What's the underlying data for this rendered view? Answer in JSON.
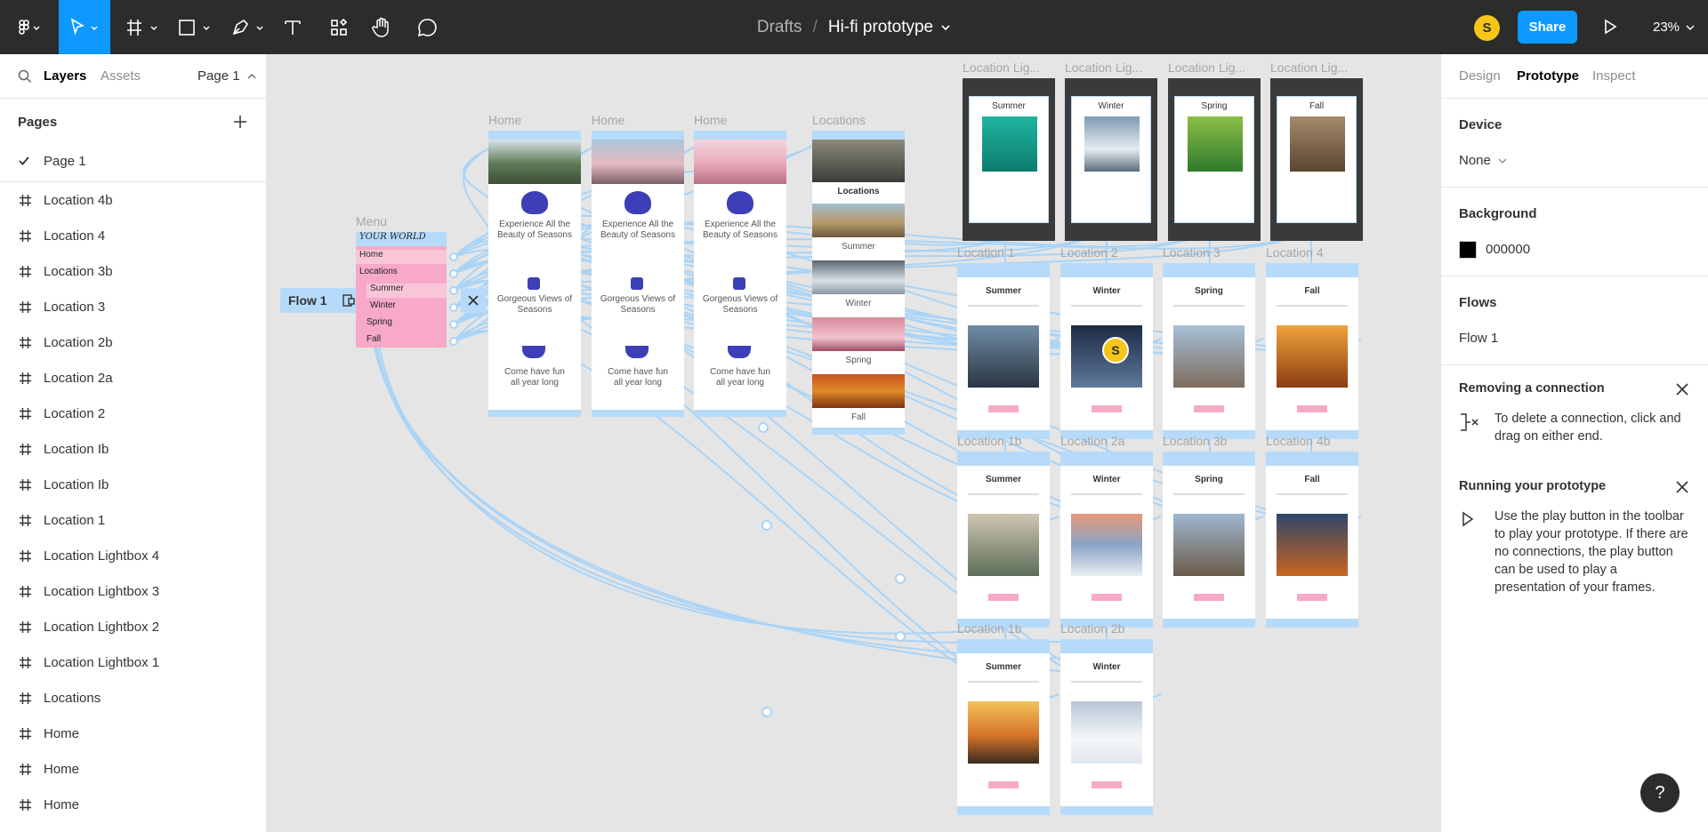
{
  "toolbar": {
    "breadcrumb_root": "Drafts",
    "breadcrumb_sep": "/",
    "project_name": "Hi-fi prototype",
    "user_initial": "S",
    "share_label": "Share",
    "zoom": "23%"
  },
  "left_panel": {
    "tabs": {
      "layers": "Layers",
      "assets": "Assets",
      "page_selector": "Page 1"
    },
    "pages_heading": "Pages",
    "pages": [
      "Page 1"
    ],
    "layers": [
      "Location 4b",
      "Location 4",
      "Location 3b",
      "Location 3",
      "Location 2b",
      "Location 2a",
      "Location 2",
      "Location Ib",
      "Location Ib",
      "Location 1",
      "Location Lightbox 4",
      "Location Lightbox 3",
      "Location Lightbox 2",
      "Location Lightbox 1",
      "Locations",
      "Home",
      "Home",
      "Home"
    ]
  },
  "right_panel": {
    "tabs": {
      "design": "Design",
      "prototype": "Prototype",
      "inspect": "Inspect"
    },
    "device_heading": "Device",
    "device_value": "None",
    "background_heading": "Background",
    "background_hex": "000000",
    "flows_heading": "Flows",
    "flow_item": "Flow 1",
    "remove_conn_heading": "Removing a connection",
    "remove_conn_text": "To delete a connection, click and drag on either end.",
    "running_heading": "Running your prototype",
    "running_text": "Use the play button in the toolbar to play your prototype. If there are no connections, the play button can be used to play a presentation of your frames."
  },
  "canvas": {
    "flow_badge": "Flow 1",
    "menu_label": "Menu",
    "menu_items": [
      "YOUR WORLD",
      "Home",
      "Locations",
      "Summer",
      "Winter",
      "Spring",
      "Fall"
    ],
    "home_label": "Home",
    "home_text": {
      "headline": "Experience All the Beauty of Seasons",
      "views": "Gorgeous Views of Seasons",
      "fun": "Come have fun all year long"
    },
    "locations_label": "Locations",
    "locations_title": "Locations",
    "seasons": [
      "Summer",
      "Winter",
      "Spring",
      "Fall"
    ],
    "lightbox_labels": [
      "Location Lig...",
      "Location Lig...",
      "Location Lig...",
      "Location Lig..."
    ],
    "row1_labels": [
      "Location 1",
      "Location 2",
      "Location 3",
      "Location 4"
    ],
    "row2_labels": [
      "Location 1b",
      "Location 2a",
      "Location 3b",
      "Location 4b"
    ],
    "row3_labels": [
      "Location 1b",
      "Location 2b"
    ],
    "cursor_initial": "S"
  },
  "colors": {
    "toolbar_bg": "#2c2c2c",
    "accent": "#0d99ff",
    "wire": "#a9d4f7",
    "frame_header": "#b6dbfa",
    "menu_pink": "#f7a9c7"
  },
  "icons": [
    "figma-menu-icon",
    "move-tool-icon",
    "frame-tool-icon",
    "rectangle-tool-icon",
    "pen-tool-icon",
    "text-tool-icon",
    "resources-icon",
    "hand-tool-icon",
    "comment-tool-icon",
    "play-icon",
    "search-icon",
    "plus-icon",
    "check-icon",
    "frame-hash-icon",
    "close-icon",
    "help-icon"
  ]
}
